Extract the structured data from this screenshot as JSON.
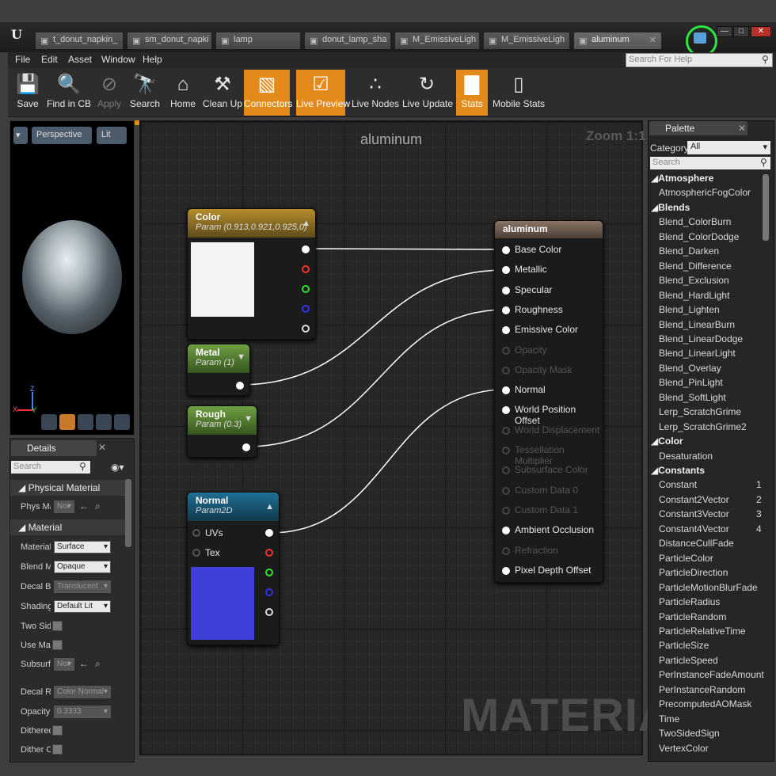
{
  "app": {
    "logo": "U"
  },
  "tabs": [
    "t_donut_napkin_",
    "sm_donut_napki",
    "lamp",
    "donut_lamp_sha",
    "M_EmissiveLigh",
    "M_EmissiveLigh",
    "aluminum"
  ],
  "menu": [
    "File",
    "Edit",
    "Asset",
    "Window",
    "Help"
  ],
  "search_help": {
    "placeholder": "Search For Help"
  },
  "toolbar": [
    {
      "label": "Save",
      "icon": "save-icon",
      "state": "normal"
    },
    {
      "label": "Find in CB",
      "icon": "magnifier-icon",
      "state": "normal"
    },
    {
      "label": "Apply",
      "icon": "apply-icon",
      "state": "disabled"
    },
    {
      "label": "Search",
      "icon": "binoculars-icon",
      "state": "normal"
    },
    {
      "label": "Home",
      "icon": "home-icon",
      "state": "normal"
    },
    {
      "label": "Clean Up",
      "icon": "broom-icon",
      "state": "normal"
    },
    {
      "label": "Connectors",
      "icon": "connectors-icon",
      "state": "active"
    },
    {
      "label": "Live Preview",
      "icon": "tv-icon",
      "state": "active"
    },
    {
      "label": "Live Nodes",
      "icon": "nodes-icon",
      "state": "normal"
    },
    {
      "label": "Live Update",
      "icon": "update-icon",
      "state": "normal"
    },
    {
      "label": "Stats",
      "icon": "stats-icon",
      "state": "active"
    },
    {
      "label": "Mobile Stats",
      "icon": "mobile-icon",
      "state": "normal"
    }
  ],
  "viewport": {
    "perspective": "Perspective",
    "lit": "Lit",
    "axis_x": "X",
    "axis_y": "Y",
    "axis_z": "Z"
  },
  "details": {
    "tab": "Details",
    "search_placeholder": "Search",
    "sections": {
      "physical": "Physical Material",
      "material": "Material"
    },
    "rows": [
      {
        "label": "Phys Ma",
        "value": "Nor",
        "type": "select-disabled"
      },
      {
        "label": "Material",
        "value": "Surface",
        "type": "select"
      },
      {
        "label": "Blend M",
        "value": "Opaque",
        "type": "select"
      },
      {
        "label": "Decal Bl",
        "value": "Translucent",
        "type": "select-disabled"
      },
      {
        "label": "Shading",
        "value": "Default Lit",
        "type": "select"
      },
      {
        "label": "Two Sid",
        "value": "",
        "type": "check"
      },
      {
        "label": "Use Mat",
        "value": "",
        "type": "check"
      },
      {
        "label": "Subsurf",
        "value": "Nor",
        "type": "select-disabled"
      },
      {
        "label": "Decal Re",
        "value": "Color Normal",
        "type": "select-disabled"
      },
      {
        "label": "Opacity",
        "value": "0.3333",
        "type": "select-disabled"
      },
      {
        "label": "Dithered",
        "value": "",
        "type": "check"
      },
      {
        "label": "Dither O",
        "value": "",
        "type": "check"
      }
    ]
  },
  "graph": {
    "title": "aluminum",
    "zoom": "Zoom 1:1",
    "watermark": "MATERIAL"
  },
  "nodes": {
    "color": {
      "title": "Color",
      "sub": "Param (0.913,0.921,0.925,0)",
      "swatch": "#f4f4f4"
    },
    "metal": {
      "title": "Metal",
      "sub": "Param (1)"
    },
    "rough": {
      "title": "Rough",
      "sub": "Param (0.3)"
    },
    "normal": {
      "title": "Normal",
      "sub": "Param2D",
      "uvs": "UVs",
      "tex": "Tex",
      "swatch": "#4040d8"
    },
    "result": {
      "title": "aluminum",
      "pins": [
        {
          "label": "Base Color",
          "active": true
        },
        {
          "label": "Metallic",
          "active": true
        },
        {
          "label": "Specular",
          "active": true
        },
        {
          "label": "Roughness",
          "active": true
        },
        {
          "label": "Emissive Color",
          "active": true
        },
        {
          "label": "Opacity",
          "active": false
        },
        {
          "label": "Opacity Mask",
          "active": false
        },
        {
          "label": "Normal",
          "active": true
        },
        {
          "label": "World Position Offset",
          "active": true
        },
        {
          "label": "World Displacement",
          "active": false
        },
        {
          "label": "Tessellation Multiplier",
          "active": false
        },
        {
          "label": "Subsurface Color",
          "active": false
        },
        {
          "label": "Custom Data 0",
          "active": false
        },
        {
          "label": "Custom Data 1",
          "active": false
        },
        {
          "label": "Ambient Occlusion",
          "active": true
        },
        {
          "label": "Refraction",
          "active": false
        },
        {
          "label": "Pixel Depth Offset",
          "active": true
        }
      ]
    }
  },
  "palette": {
    "tab": "Palette",
    "category_label": "Category:",
    "category_value": "All",
    "search_placeholder": "Search",
    "items": [
      {
        "t": "g",
        "l": "Atmosphere"
      },
      {
        "t": "i",
        "l": "AtmosphericFogColor"
      },
      {
        "t": "g",
        "l": "Blends"
      },
      {
        "t": "i",
        "l": "Blend_ColorBurn"
      },
      {
        "t": "i",
        "l": "Blend_ColorDodge"
      },
      {
        "t": "i",
        "l": "Blend_Darken"
      },
      {
        "t": "i",
        "l": "Blend_Difference"
      },
      {
        "t": "i",
        "l": "Blend_Exclusion"
      },
      {
        "t": "i",
        "l": "Blend_HardLight"
      },
      {
        "t": "i",
        "l": "Blend_Lighten"
      },
      {
        "t": "i",
        "l": "Blend_LinearBurn"
      },
      {
        "t": "i",
        "l": "Blend_LinearDodge"
      },
      {
        "t": "i",
        "l": "Blend_LinearLight"
      },
      {
        "t": "i",
        "l": "Blend_Overlay"
      },
      {
        "t": "i",
        "l": "Blend_PinLight"
      },
      {
        "t": "i",
        "l": "Blend_SoftLight"
      },
      {
        "t": "i",
        "l": "Lerp_ScratchGrime"
      },
      {
        "t": "i",
        "l": "Lerp_ScratchGrime2"
      },
      {
        "t": "g",
        "l": "Color"
      },
      {
        "t": "i",
        "l": "Desaturation"
      },
      {
        "t": "g",
        "l": "Constants"
      },
      {
        "t": "i",
        "l": "Constant",
        "k": "1"
      },
      {
        "t": "i",
        "l": "Constant2Vector",
        "k": "2"
      },
      {
        "t": "i",
        "l": "Constant3Vector",
        "k": "3"
      },
      {
        "t": "i",
        "l": "Constant4Vector",
        "k": "4"
      },
      {
        "t": "i",
        "l": "DistanceCullFade"
      },
      {
        "t": "i",
        "l": "ParticleColor"
      },
      {
        "t": "i",
        "l": "ParticleDirection"
      },
      {
        "t": "i",
        "l": "ParticleMotionBlurFade"
      },
      {
        "t": "i",
        "l": "ParticleRadius"
      },
      {
        "t": "i",
        "l": "ParticleRandom"
      },
      {
        "t": "i",
        "l": "ParticleRelativeTime"
      },
      {
        "t": "i",
        "l": "ParticleSize"
      },
      {
        "t": "i",
        "l": "ParticleSpeed"
      },
      {
        "t": "i",
        "l": "PerInstanceFadeAmount"
      },
      {
        "t": "i",
        "l": "PerInstanceRandom"
      },
      {
        "t": "i",
        "l": "PrecomputedAOMask"
      },
      {
        "t": "i",
        "l": "Time"
      },
      {
        "t": "i",
        "l": "TwoSidedSign"
      },
      {
        "t": "i",
        "l": "VertexColor"
      }
    ]
  },
  "colors": {
    "accent": "#e38a1b",
    "highlight_ring": "#2be63e"
  }
}
